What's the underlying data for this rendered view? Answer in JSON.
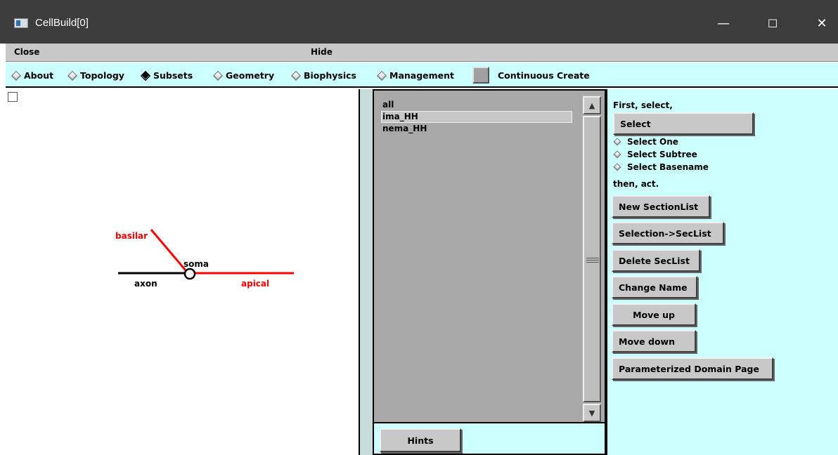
{
  "window": {
    "title": "CellBuild[0]",
    "minimize_glyph": "—",
    "maximize_glyph": "☐",
    "close_glyph": "✕"
  },
  "menu": {
    "close": "Close",
    "hide": "Hide"
  },
  "tabs": [
    {
      "label": "About",
      "selected": false
    },
    {
      "label": "Topology",
      "selected": false
    },
    {
      "label": "Subsets",
      "selected": true
    },
    {
      "label": "Geometry",
      "selected": false
    },
    {
      "label": "Biophysics",
      "selected": false
    },
    {
      "label": "Management",
      "selected": false
    }
  ],
  "continuous_create": {
    "label": "Continuous Create",
    "checked": false
  },
  "diagram": {
    "labels": {
      "basilar": "basilar",
      "soma": "soma",
      "axon": "axon",
      "apical": "apical"
    },
    "colors": {
      "selected": "#ff0000",
      "unselected": "#000000"
    }
  },
  "subsets": {
    "items": [
      "all",
      "ima_HH",
      "nema_HH"
    ],
    "selected_index": 1
  },
  "hints_label": "Hints",
  "actions": {
    "first_select": "First, select,",
    "select_button": "Select",
    "select_modes": [
      "Select One",
      "Select Subtree",
      "Select Basename"
    ],
    "then_act": "then, act.",
    "buttons": [
      "New SectionList",
      "Selection->SecList",
      "Delete SecList",
      "Change Name",
      "Move up",
      "Move down",
      "Parameterized Domain Page"
    ]
  }
}
